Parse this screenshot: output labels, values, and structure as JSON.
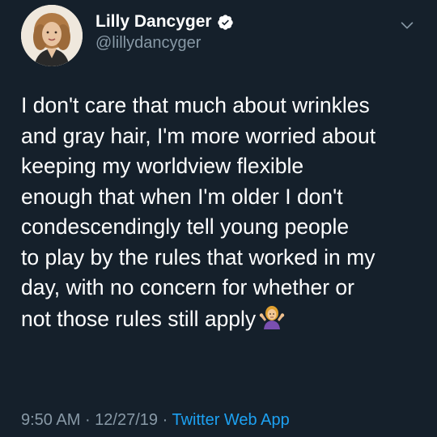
{
  "user": {
    "display_name": "Lilly Dancyger",
    "handle": "@lillydancyger",
    "verified": true,
    "avatar_icon": "profile-photo"
  },
  "tweet": {
    "lines": [
      "I don't care that much about wrinkles",
      "and gray hair, I'm more worried about",
      "keeping my worldview flexible",
      "enough that when I'm older I don't",
      "condescendingly tell young people",
      "to play by the rules that worked in my",
      "day, with no concern for whether or",
      "not those rules still apply"
    ],
    "emoji": "person-shrugging-emoji"
  },
  "meta": {
    "time": "9:50 AM",
    "separator": " · ",
    "date": "12/27/19",
    "source": "Twitter Web App"
  },
  "colors": {
    "background": "#15202b",
    "text": "#ffffff",
    "secondary": "#8899a6",
    "accent": "#1da1f2"
  },
  "icons": {
    "menu": "chevron-down-icon",
    "verified": "verified-badge-icon"
  }
}
